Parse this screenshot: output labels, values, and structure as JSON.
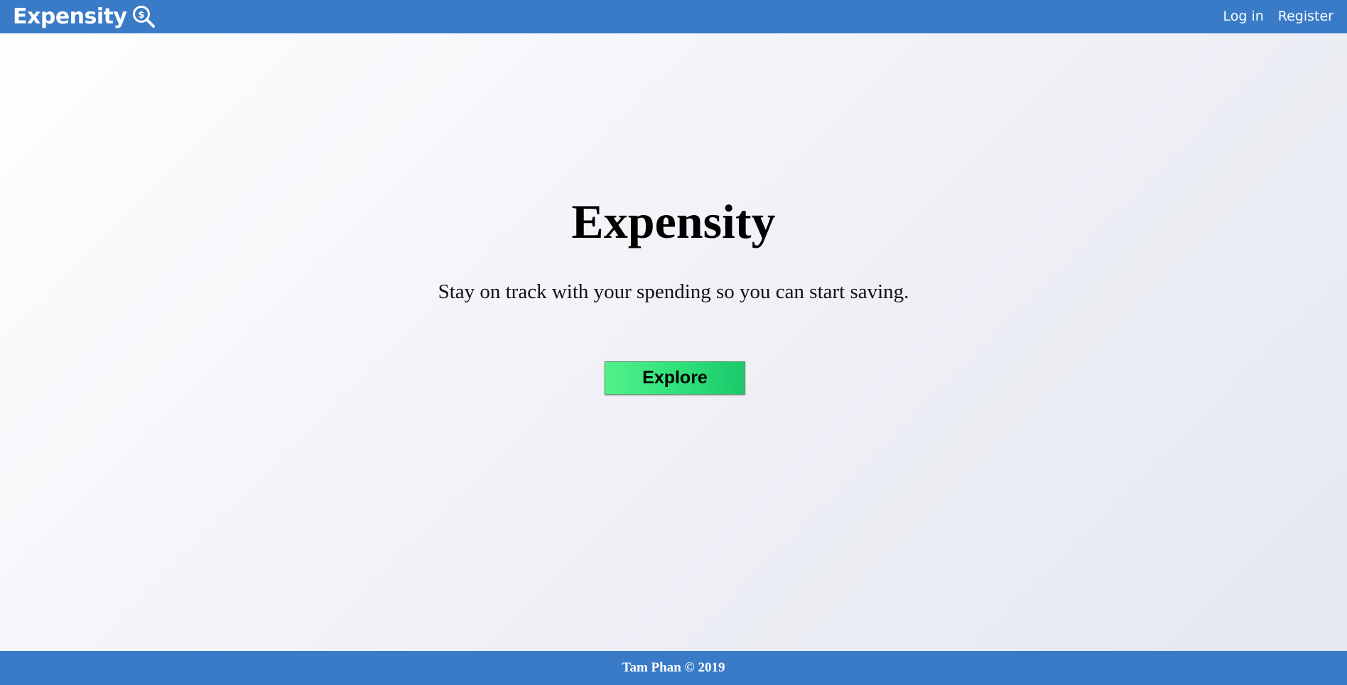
{
  "navbar": {
    "brand": "Expensity",
    "brand_icon": "magnifier-dollar-icon",
    "links": {
      "login": "Log in",
      "register": "Register"
    },
    "color": "#3a7bc8"
  },
  "hero": {
    "title": "Expensity",
    "subtitle": "Stay on track with your spending so you can start saving.",
    "cta_label": "Explore",
    "cta_color": "#2ee07a"
  },
  "footer": {
    "text": "Tam Phan © 2019",
    "color": "#3a7bc8"
  }
}
